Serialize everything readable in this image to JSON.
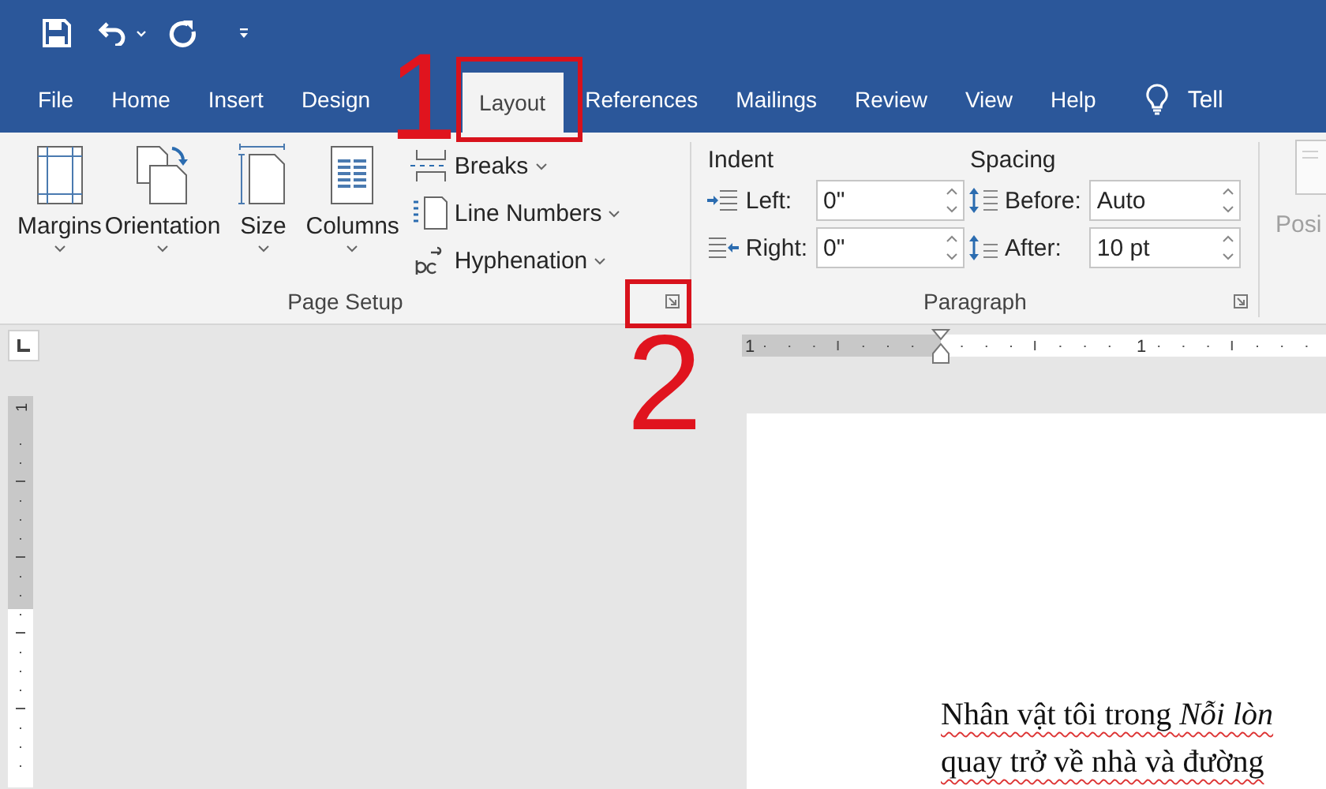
{
  "tabs": [
    {
      "label": "File",
      "selected": false
    },
    {
      "label": "Home",
      "selected": false
    },
    {
      "label": "Insert",
      "selected": false
    },
    {
      "label": "Design",
      "selected": false
    },
    {
      "label": "Layout",
      "selected": true
    },
    {
      "label": "References",
      "selected": false
    },
    {
      "label": "Mailings",
      "selected": false
    },
    {
      "label": "Review",
      "selected": false
    },
    {
      "label": "View",
      "selected": false
    },
    {
      "label": "Help",
      "selected": false
    }
  ],
  "tell_me": {
    "label": "Tell"
  },
  "page_setup": {
    "label": "Page Setup",
    "large_buttons": [
      {
        "label": "Margins"
      },
      {
        "label": "Orientation"
      },
      {
        "label": "Size"
      },
      {
        "label": "Columns"
      }
    ],
    "small_buttons": [
      {
        "label": "Breaks"
      },
      {
        "label": "Line Numbers"
      },
      {
        "label": "Hyphenation"
      }
    ]
  },
  "paragraph": {
    "label": "Paragraph",
    "indent": {
      "heading": "Indent",
      "fields": [
        {
          "label": "Left:",
          "value": "0\""
        },
        {
          "label": "Right:",
          "value": "0\""
        }
      ]
    },
    "spacing": {
      "heading": "Spacing",
      "fields": [
        {
          "label": "Before:",
          "value": "Auto"
        },
        {
          "label": "After:",
          "value": "10 pt"
        }
      ]
    }
  },
  "next_group": {
    "label": "Posi",
    "disabled": true
  },
  "ruler": {
    "horizontal_labels": [
      "1",
      "1"
    ],
    "vertical_labels": [
      "1"
    ]
  },
  "document": {
    "lines": [
      "Nhân vật tôi trong *Nỗi lòn*",
      "quay trở về nhà và đường"
    ]
  },
  "annotations": [
    {
      "label": "1"
    },
    {
      "label": "2"
    }
  ]
}
